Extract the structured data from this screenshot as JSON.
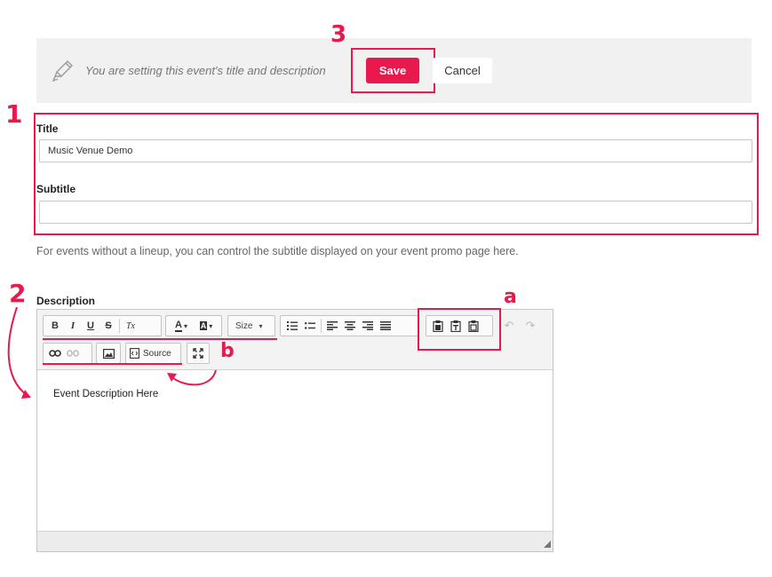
{
  "notice": {
    "icon": "pencil-icon",
    "text": "You are setting this event's title and description",
    "save_label": "Save",
    "cancel_label": "Cancel"
  },
  "form": {
    "title_label": "Title",
    "title_value": "Music Venue Demo",
    "subtitle_label": "Subtitle",
    "subtitle_value": "",
    "helper_text": "For events without a lineup, you can control the subtitle displayed on your event promo page here.",
    "description_label": "Description"
  },
  "editor": {
    "toolbar_row1": {
      "bold": "B",
      "italic": "I",
      "underline": "U",
      "strike": "S",
      "remove_format": "Tx",
      "text_color": "A",
      "bg_color": "A",
      "size_label": "Size"
    },
    "source_label": "Source",
    "content": "Event Description Here"
  },
  "annotations": {
    "n1": "1",
    "n2": "2",
    "n3": "3",
    "a": "a",
    "b": "b"
  },
  "colors": {
    "accent": "#e8194c",
    "notice_bg": "#f1f1f1",
    "toolbar_bg": "#f3f3f3"
  }
}
